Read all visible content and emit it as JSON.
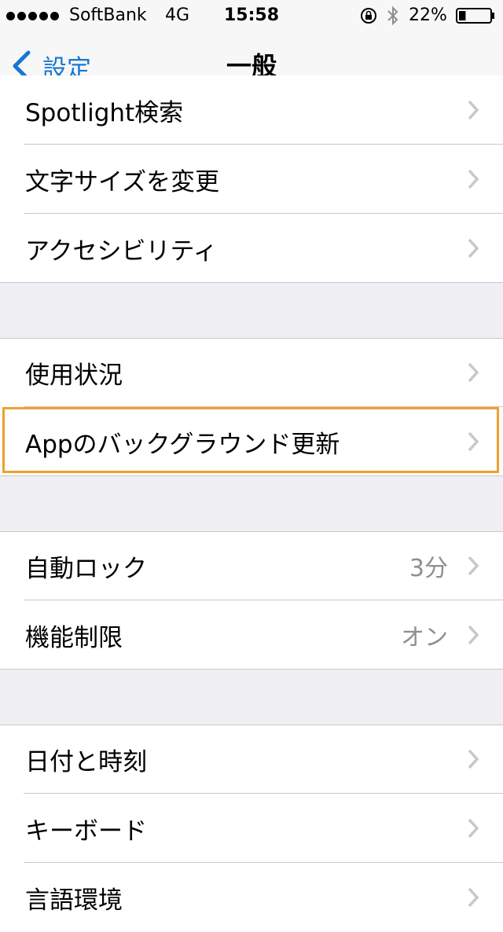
{
  "status_bar": {
    "carrier": "SoftBank",
    "network": "4G",
    "time": "15:58",
    "battery_percent": "22%",
    "battery_level": 0.22,
    "icons": [
      "signal-dots-icon",
      "rotation-lock-icon",
      "bluetooth-icon",
      "battery-icon"
    ]
  },
  "nav": {
    "back_label": "設定",
    "title": "一般"
  },
  "groups": [
    {
      "rows": [
        {
          "label": "Spotlight検索"
        },
        {
          "label": "文字サイズを変更"
        },
        {
          "label": "アクセシビリティ"
        }
      ]
    },
    {
      "rows": [
        {
          "label": "使用状況"
        },
        {
          "label": "Appのバックグラウンド更新"
        }
      ]
    },
    {
      "rows": [
        {
          "label": "自動ロック",
          "value": "3分"
        },
        {
          "label": "機能制限",
          "value": "オン"
        }
      ]
    },
    {
      "rows": [
        {
          "label": "日付と時刻"
        },
        {
          "label": "キーボード"
        },
        {
          "label": "言語環境"
        }
      ]
    }
  ],
  "colors": {
    "accent": "#1677d2",
    "highlight_border": "#f0a030",
    "background": "#efeff4",
    "secondary_text": "#8e8e93"
  }
}
